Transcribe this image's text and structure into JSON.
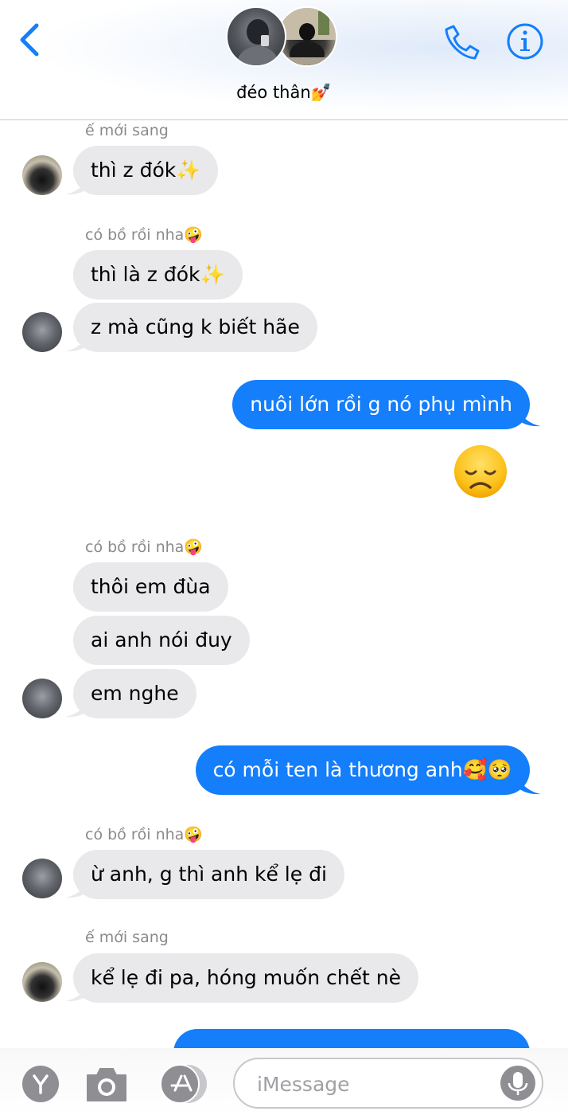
{
  "header": {
    "title": "đéo thân💅",
    "back_icon": "chevron-left-icon",
    "call_icon": "phone-icon",
    "info_icon": "info-icon",
    "accent_color": "#147efb"
  },
  "messages": [
    {
      "sender": "ế mới sang"
    },
    {
      "text": "thì z đók✨"
    },
    {
      "sender": "có bồ rồi nha🤪"
    },
    {
      "text": "thì là z đók✨"
    },
    {
      "text": "z mà cũng k biết hãe"
    },
    {
      "text": "nuôi lớn rồi g nó phụ mình"
    },
    {
      "emoji": "😞"
    },
    {
      "sender": "có bồ rồi nha🤪"
    },
    {
      "text": "thôi em đùa"
    },
    {
      "text": "ai anh nói đuy"
    },
    {
      "text": "em nghe"
    },
    {
      "text": "có mỗi ten là thương anh🥰🥺"
    },
    {
      "sender": "có bồ rồi nha🤪"
    },
    {
      "text": "ừ anh, g thì anh kể lẹ đi"
    },
    {
      "sender": "ế mới sang"
    },
    {
      "text": "kể lẹ đi pa, hóng muốn chết nè"
    }
  ],
  "bottom_bar": {
    "input_placeholder": "iMessage",
    "icons": [
      "y-app-icon",
      "camera-icon",
      "app-store-icon",
      "microphone-icon"
    ]
  }
}
